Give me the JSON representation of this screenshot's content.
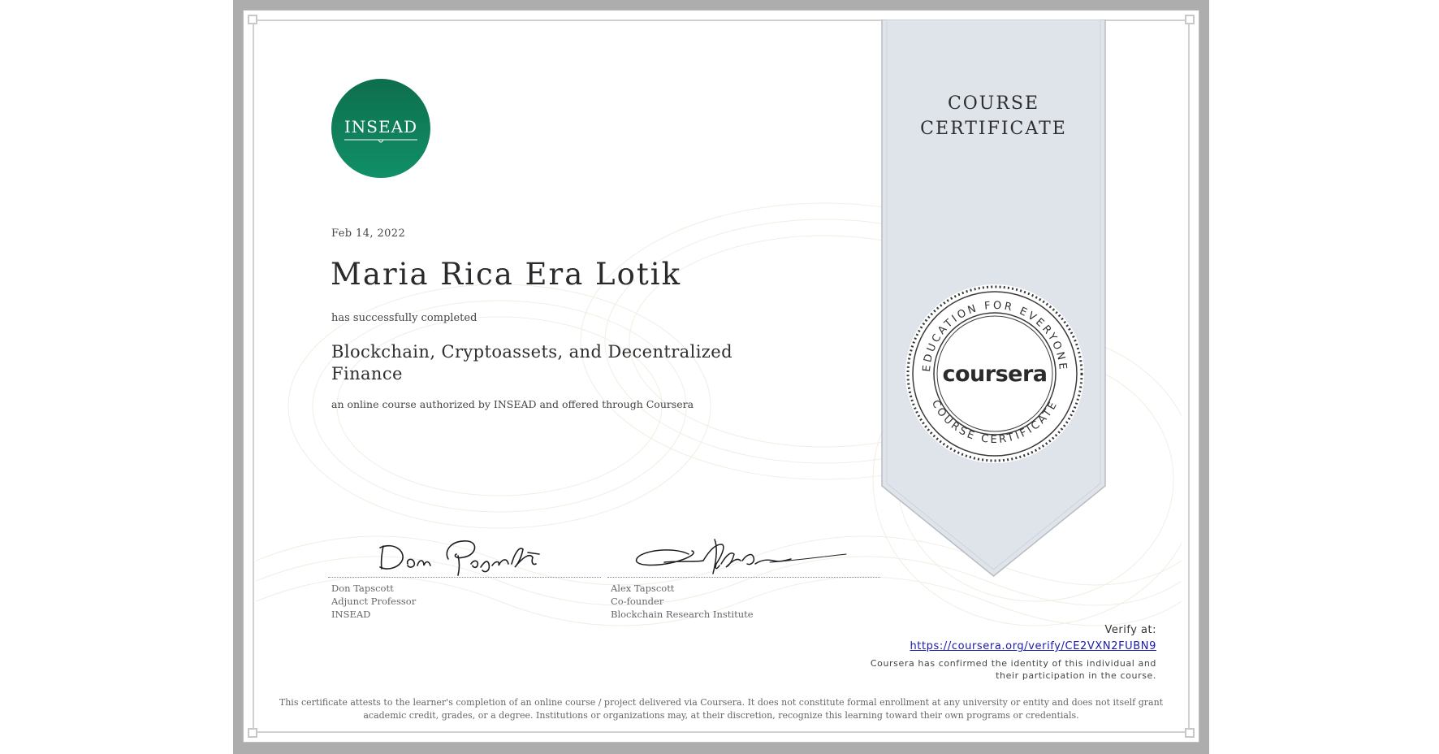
{
  "certificate": {
    "type_label_line1": "COURSE",
    "type_label_line2": "CERTIFICATE",
    "issue_date": "Feb 14, 2022",
    "recipient_name": "Maria Rica Era Lotik",
    "completed_text": "has successfully completed",
    "course_name": "Blockchain, Cryptoassets, and Decentralized Finance",
    "authorization_text": "an online course authorized by INSEAD and offered through Coursera"
  },
  "logo": {
    "text": "INSEAD",
    "color_top": "#0d6e4c",
    "color_bottom": "#119068"
  },
  "seal": {
    "top_text": "EDUCATION FOR EVERYONE",
    "bottom_text": "COURSE CERTIFICATE",
    "brand": "coursera"
  },
  "signatories": [
    {
      "name": "Don Tapscott",
      "title": "Adjunct Professor",
      "organization": "INSEAD"
    },
    {
      "name": "Alex Tapscott",
      "title": "Co-founder",
      "organization": "Blockchain Research Institute"
    }
  ],
  "verify": {
    "label": "Verify at:",
    "url": "https://coursera.org/verify/CE2VXN2FUBN9",
    "confirmation": "Coursera has confirmed the identity of this individual and their participation in the course."
  },
  "disclaimer": "This certificate attests to the learner's completion of an online course / project delivered via Coursera. It does not constitute formal enrollment at any university or entity and does not itself grant academic credit, grades, or a degree. Institutions or organizations may, at their discretion, recognize this learning toward their own programs or credentials.",
  "colors": {
    "ribbon": "#dfe3ea",
    "frame": "#adadad",
    "link": "#1a1aa8"
  }
}
